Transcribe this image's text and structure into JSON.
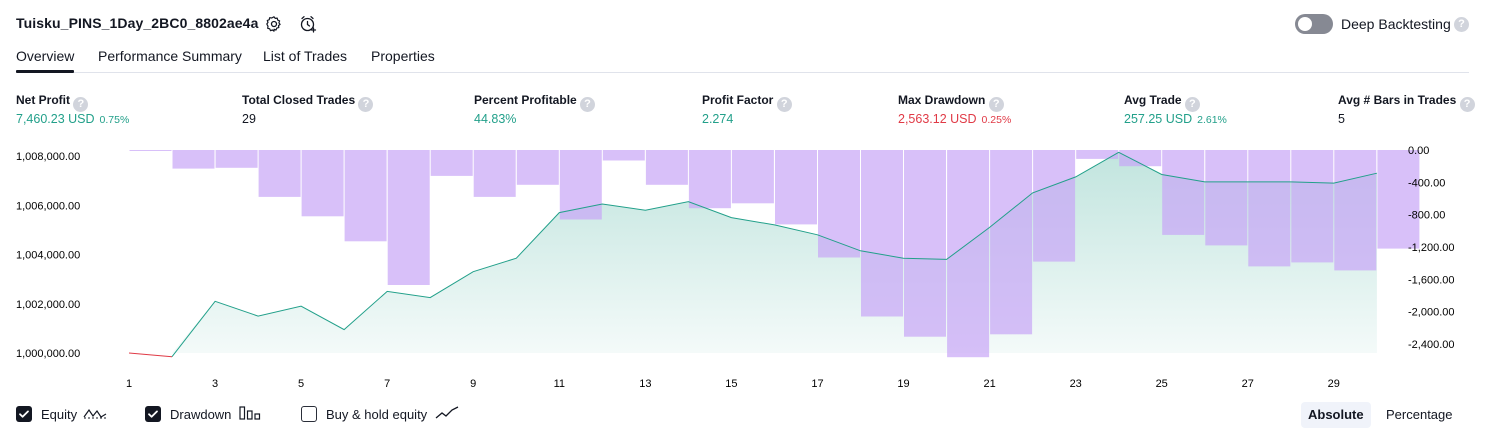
{
  "header": {
    "title": "Tuisku_PINS_1Day_2BC0_8802ae4a",
    "deep_backtesting_label": "Deep Backtesting",
    "deep_backtesting_enabled": false,
    "help_glyph": "?"
  },
  "tabs": [
    {
      "label": "Overview",
      "active": true
    },
    {
      "label": "Performance Summary",
      "active": false
    },
    {
      "label": "List of Trades",
      "active": false
    },
    {
      "label": "Properties",
      "active": false
    }
  ],
  "stats": [
    {
      "label": "Net Profit",
      "value": "7,460.23 USD",
      "pct": "0.75%",
      "color": "#22a08a"
    },
    {
      "label": "Total Closed Trades",
      "value": "29",
      "pct": "",
      "color": "#131722"
    },
    {
      "label": "Percent Profitable",
      "value": "44.83%",
      "pct": "",
      "color": "#22a08a"
    },
    {
      "label": "Profit Factor",
      "value": "2.274",
      "pct": "",
      "color": "#22a08a"
    },
    {
      "label": "Max Drawdown",
      "value": "2,563.12 USD",
      "pct": "0.25%",
      "color": "#e03a46"
    },
    {
      "label": "Avg Trade",
      "value": "257.25 USD",
      "pct": "2.61%",
      "color": "#22a08a"
    },
    {
      "label": "Avg # Bars in Trades",
      "value": "5",
      "pct": "",
      "color": "#131722"
    }
  ],
  "chart_data": {
    "type": "area",
    "x": [
      1,
      2,
      3,
      4,
      5,
      6,
      7,
      8,
      9,
      10,
      11,
      12,
      13,
      14,
      15,
      16,
      17,
      18,
      19,
      20,
      21,
      22,
      23,
      24,
      25,
      26,
      27,
      28,
      29,
      30
    ],
    "x_tick_labels": [
      "1",
      "3",
      "5",
      "7",
      "9",
      "11",
      "13",
      "15",
      "17",
      "19",
      "21",
      "23",
      "25",
      "27",
      "29"
    ],
    "y_left_tick_labels": [
      "1,008,000.00",
      "1,006,000.00",
      "1,004,000.00",
      "1,002,000.00",
      "1,000,000.00"
    ],
    "y_left_range": [
      1000000,
      1008000
    ],
    "y_right_tick_labels": [
      "0.00",
      "-400.00",
      "-800.00",
      "-1,200.00",
      "-1,600.00",
      "-2,000.00",
      "-2,400.00"
    ],
    "y_right_range": [
      -2400,
      0
    ],
    "series": [
      {
        "name": "Equity",
        "chart_type": "area",
        "values": [
          1000000,
          999850,
          1002100,
          1001500,
          1001900,
          1000950,
          1002500,
          1002250,
          1003300,
          1003850,
          1005700,
          1006050,
          1005800,
          1006150,
          1005500,
          1005200,
          1004800,
          1004150,
          1003850,
          1003800,
          1005100,
          1006500,
          1007150,
          1008150,
          1007250,
          1006950,
          1006950,
          1006950,
          1006900,
          1007300
        ],
        "colors": {
          "above_start": "#22a08a",
          "below_start": "#e03a46"
        }
      },
      {
        "name": "Drawdown",
        "chart_type": "bar",
        "values": [
          0,
          -230,
          -220,
          -580,
          -820,
          -1130,
          -1670,
          -320,
          -580,
          -430,
          -860,
          -130,
          -430,
          -720,
          -660,
          -920,
          -1330,
          -2060,
          -2310,
          -2563,
          -2280,
          -1380,
          -110,
          -200,
          -1050,
          -1180,
          -1440,
          -1390,
          -1490,
          -1220
        ],
        "color": "#c8a5f7"
      }
    ]
  },
  "legend": [
    {
      "label": "Equity",
      "checked": true,
      "icon": "equity-line-icon"
    },
    {
      "label": "Drawdown",
      "checked": true,
      "icon": "drawdown-bars-icon"
    },
    {
      "label": "Buy & hold equity",
      "checked": false,
      "icon": "buy-hold-line-icon"
    }
  ],
  "modes": [
    {
      "label": "Absolute",
      "active": true
    },
    {
      "label": "Percentage",
      "active": false
    }
  ]
}
